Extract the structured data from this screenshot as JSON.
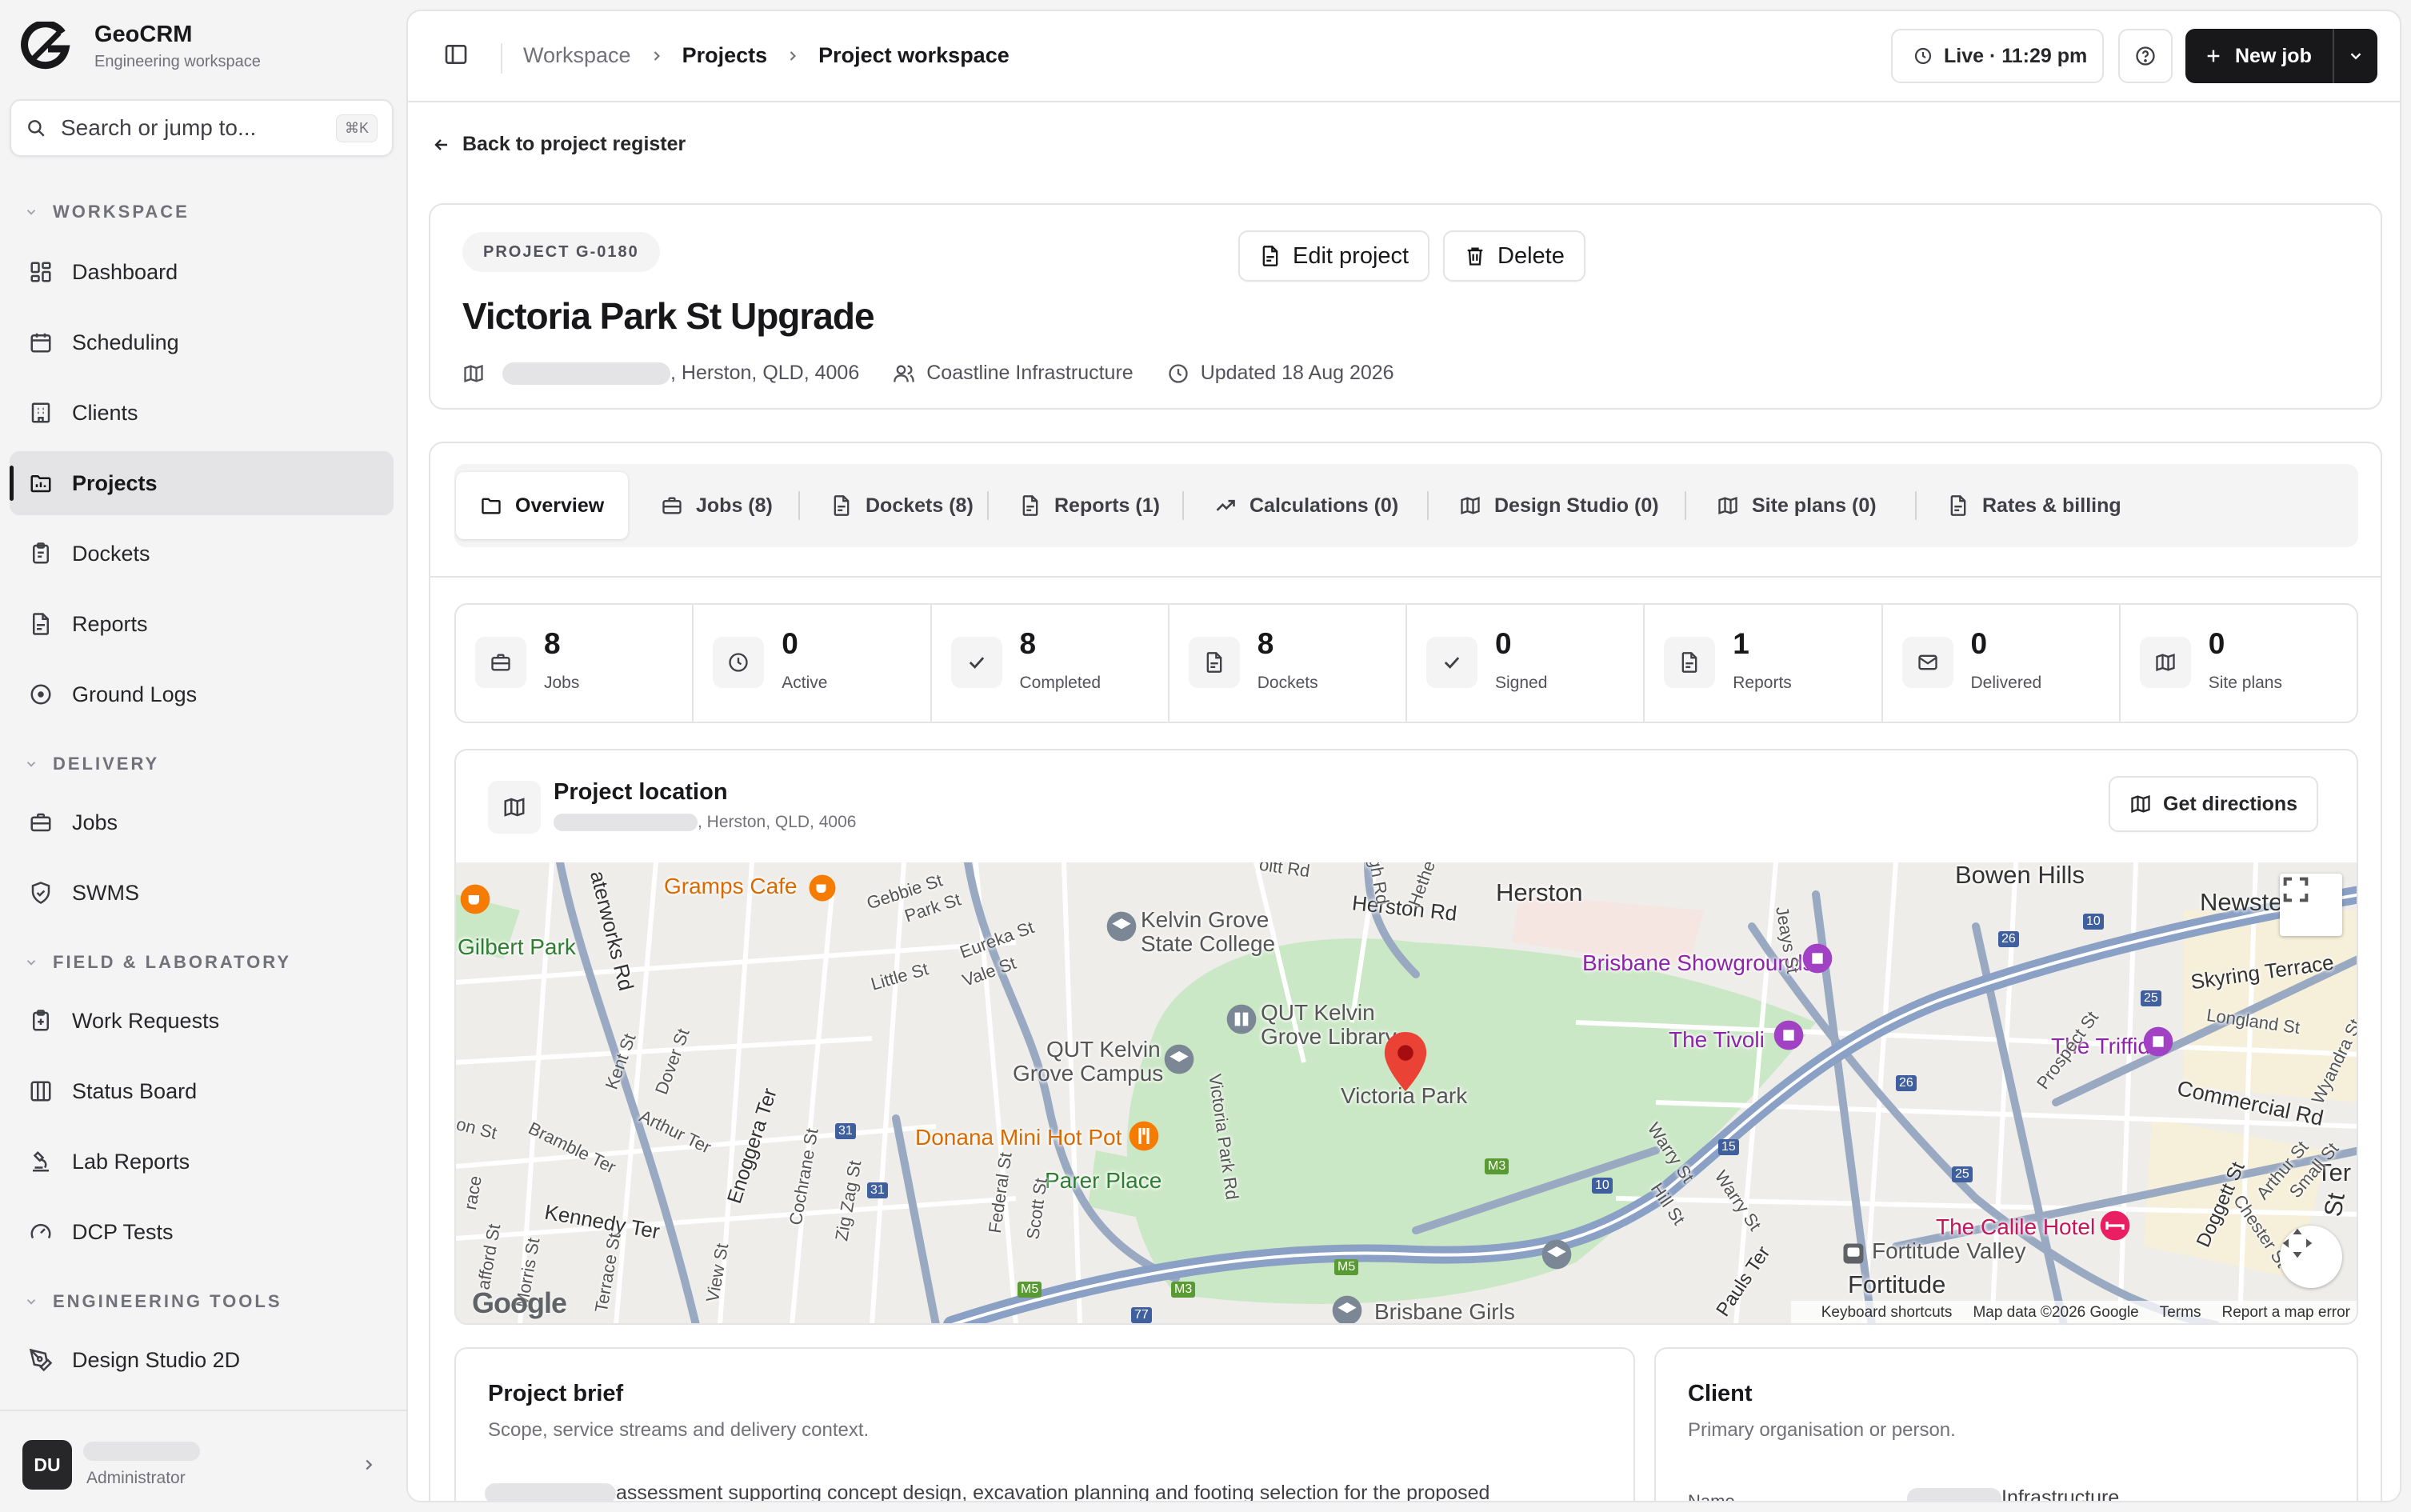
{
  "app": {
    "name": "GeoCRM",
    "subtitle": "Engineering workspace"
  },
  "search": {
    "placeholder": "Search or jump to...",
    "shortcut": "⌘K"
  },
  "sections": {
    "workspace": "WORKSPACE",
    "delivery": "DELIVERY",
    "field": "FIELD & LABORATORY",
    "tools": "ENGINEERING TOOLS"
  },
  "nav": {
    "dashboard": "Dashboard",
    "scheduling": "Scheduling",
    "clients": "Clients",
    "projects": "Projects",
    "dockets": "Dockets",
    "reports": "Reports",
    "ground_logs": "Ground Logs",
    "jobs": "Jobs",
    "swms": "SWMS",
    "work_requests": "Work Requests",
    "status_board": "Status Board",
    "lab_reports": "Lab Reports",
    "dcp_tests": "DCP Tests",
    "design_studio": "Design Studio 2D"
  },
  "user": {
    "initials": "DU",
    "role": "Administrator"
  },
  "topbar": {
    "breadcrumb": [
      "Workspace",
      "Projects",
      "Project workspace"
    ],
    "live": "Live · 11:29 pm",
    "new_job": "New job"
  },
  "back_link": "Back to project register",
  "project": {
    "code": "PROJECT G-0180",
    "title": "Victoria Park St Upgrade",
    "address_suffix": ", Herston, QLD, 4006",
    "client": "Coastline Infrastructure",
    "updated": "Updated 18 Aug 2026",
    "edit": "Edit project",
    "delete": "Delete"
  },
  "tabs": [
    "Overview",
    "Jobs (8)",
    "Dockets (8)",
    "Reports (1)",
    "Calculations (0)",
    "Design Studio (0)",
    "Site plans (0)",
    "Rates & billing"
  ],
  "stats": [
    {
      "value": "8",
      "label": "Jobs"
    },
    {
      "value": "0",
      "label": "Active"
    },
    {
      "value": "8",
      "label": "Completed"
    },
    {
      "value": "8",
      "label": "Dockets"
    },
    {
      "value": "0",
      "label": "Signed"
    },
    {
      "value": "1",
      "label": "Reports"
    },
    {
      "value": "0",
      "label": "Delivered"
    },
    {
      "value": "0",
      "label": "Site plans"
    }
  ],
  "location": {
    "title": "Project location",
    "address_suffix": ", Herston, QLD, 4006",
    "directions": "Get directions"
  },
  "map": {
    "places": {
      "herston": "Herston",
      "bowen_hills": "Bowen Hills",
      "newstead": "Newste",
      "gramps": "Gramps Cafe",
      "gilbert_park": "Gilbert Park",
      "kelvin_grove_college_1": "Kelvin Grove",
      "kelvin_grove_college_2": "State College",
      "qut_library_1": "QUT Kelvin",
      "qut_library_2": "Grove Library",
      "qut_campus_1": "QUT Kelvin",
      "qut_campus_2": "Grove Campus",
      "victoria_park": "Victoria Park",
      "donana": "Donana Mini Hot Pot",
      "parer_place": "Parer Place",
      "showgrounds": "Brisbane Showgrounds",
      "tivoli": "The Tivoli",
      "triffid": "The Triffid",
      "calile": "The Calile Hotel",
      "fortitude_valley": "Fortitude Valley",
      "fortitude": "Fortitude",
      "brisbane_girls": "Brisbane Girls",
      "skyring": "Skyring Terrace",
      "commercial": "Commercial Rd",
      "longland": "Longland St",
      "ter": "Ter",
      "st": "St"
    },
    "streets": {
      "herston_rd": "Herston Rd",
      "waterworks": "aterworks Rd",
      "gebbie": "Gebbie St",
      "park": "Park St",
      "eureka": "Eureka St",
      "little": "Little St",
      "vale": "Vale St",
      "kent": "Kent St",
      "dover": "Dover St",
      "arthur_ter": "Arthur Ter",
      "bramble": "Bramble Ter",
      "enoggera": "Enoggera Ter",
      "cochrane": "Cochrane St",
      "ziz_zag": "Zig Zag St",
      "kennedy": "Kennedy Ter",
      "federal": "Federal St",
      "scott": "Scott St",
      "victoria_park_rd": "Victoria Park Rd",
      "warry1": "Warry St",
      "warry2": "Warry St",
      "hill": "Hill St",
      "jeays": "Jeays St",
      "prospect": "Prospect St",
      "wyandra": "Wyandra St",
      "doggett": "Doggett St",
      "chester": "Chester St",
      "arthur_st": "Arthur St",
      "small": "Small St",
      "pauls": "Pauls Ter",
      "morris": "Morris St",
      "terrace": "Terrace St",
      "view": "View St",
      "afford": "afford St",
      "race": "race",
      "on_st": "on St",
      "oltt": "oltt Rd",
      "gh_rd": "gh Rd",
      "hether": "Hether"
    },
    "shields": [
      "M3",
      "M3",
      "M5",
      "M5",
      "M3",
      "31",
      "31",
      "15",
      "10",
      "10",
      "26",
      "26",
      "25",
      "25",
      "77"
    ],
    "brand": "Google",
    "footer": [
      "Keyboard shortcuts",
      "Map data ©2026 Google",
      "Terms",
      "Report a map error"
    ]
  },
  "brief": {
    "title": "Project brief",
    "subtitle": "Scope, service streams and delivery context.",
    "text": "assessment supporting concept design, excavation planning and footing selection for the proposed"
  },
  "client_card": {
    "title": "Client",
    "subtitle": "Primary organisation or person.",
    "name_label": "Name",
    "name_suffix": "Infrastructure"
  }
}
